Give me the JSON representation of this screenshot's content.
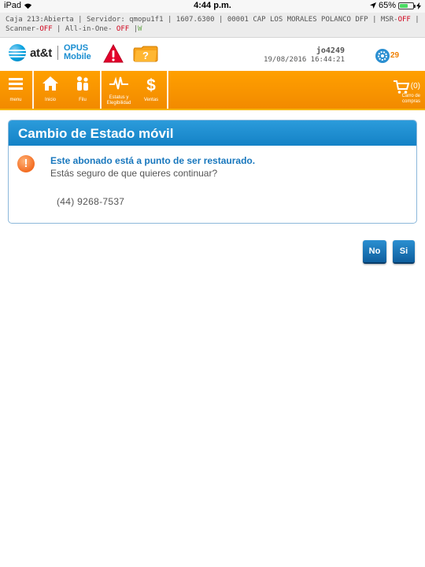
{
  "status_bar": {
    "device": "iPad",
    "time": "4:44 p.m.",
    "battery": "65%",
    "battery_level": 0.65
  },
  "session": {
    "caja": "Caja 213:Abierta",
    "servidor": "Servidor: qmopu1f1",
    "version": "1607.6300",
    "store": "00001 CAP LOS MORALES POLANCO DFP",
    "msr_label": "MSR-",
    "msr_value": "OFF",
    "scanner_label": "Scanner-",
    "scanner_value": "OFF",
    "allinone_label": "All-in-One-",
    "allinone_value": "OFF",
    "suffix": "W",
    "separator": "|"
  },
  "header": {
    "brand": "at&t",
    "product_line1": "OPUS",
    "product_line2": "Mobile",
    "username": "jo4249",
    "datetime": "19/08/2016 16:44:21",
    "notifications_count": "29",
    "icons": [
      "alert-triangle-icon",
      "help-folder-icon",
      "settings-gear-icon"
    ]
  },
  "nav": {
    "menu": "menu",
    "inicio": "Inicio",
    "filu": "Filu",
    "estatus_1": "Estatus y",
    "estatus_2": "Elegibilidad",
    "ventas": "Ventas",
    "cart_count": "(0)",
    "cart_label_1": "Carro de",
    "cart_label_2": "compras"
  },
  "dialog": {
    "title": "Cambio de Estado móvil",
    "message_title": "Este abonado está a punto de ser restaurado.",
    "message_sub": "Estás seguro de que quieres continuar?",
    "phone": "(44) 9268-7537"
  },
  "buttons": {
    "no": "No",
    "si": "Si"
  },
  "colors": {
    "accent_orange": "#f28a00",
    "dialog_blue": "#1482c6",
    "off_red": "#d0021b"
  }
}
